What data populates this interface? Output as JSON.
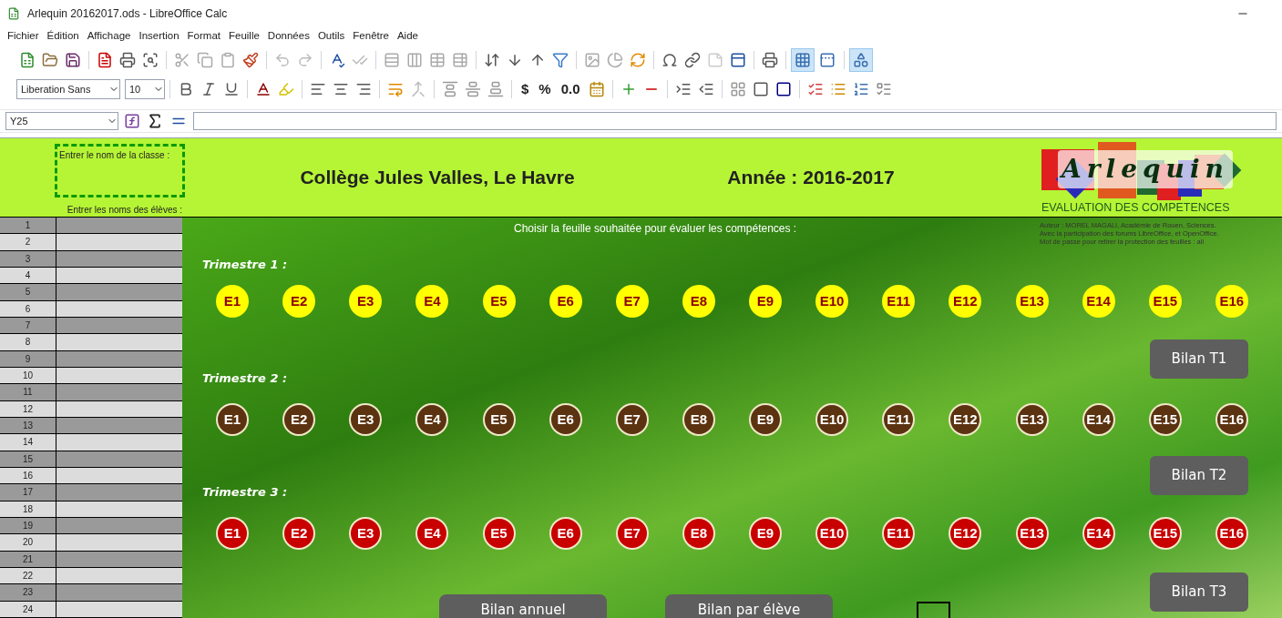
{
  "window": {
    "title": "Arlequin 20162017.ods - LibreOffice Calc"
  },
  "menu": [
    "Fichier",
    "Édition",
    "Affichage",
    "Insertion",
    "Format",
    "Feuille",
    "Données",
    "Outils",
    "Fenêtre",
    "Aide"
  ],
  "toolbar": {
    "view_toggles": [
      {
        "on": true
      },
      {
        "on": false
      },
      {
        "on": true
      }
    ],
    "font_name": "Liberation Sans",
    "font_size": "10",
    "format_buttons": [
      "$",
      "%",
      "0.0"
    ]
  },
  "formula_bar": {
    "name_box": "Y25"
  },
  "sheet": {
    "class_label": "Entrer le nom de la classe :",
    "students_label": "Entrer les noms des élèves :",
    "title": "Collège Jules Valles, Le Havre",
    "year": "Année : 2016-2017",
    "logo_text": "Arlequin",
    "logo_caption": "EVALUATION DES COMPETENCES",
    "author_lines": [
      "Auteur : MOREL MAGALI, Académie de Rouen, Sciences.",
      "Avec la participation des forums LibreOffice, et OpenOffice.",
      "Mot de passe pour retirer la protection des feuilles : ali"
    ],
    "instruction": "Choisir la feuille souhaitée pour évaluer les compétences :",
    "rows": [
      "1",
      "2",
      "3",
      "4",
      "5",
      "6",
      "7",
      "8",
      "9",
      "10",
      "11",
      "12",
      "13",
      "14",
      "15",
      "16",
      "17",
      "18",
      "19",
      "20",
      "21",
      "22",
      "23",
      "24"
    ],
    "trimestres": [
      {
        "label": "Trimestre 1 :",
        "kind": "light",
        "color": "#ffff00",
        "items": [
          "E1",
          "E2",
          "E3",
          "E4",
          "E5",
          "E6",
          "E7",
          "E8",
          "E9",
          "E10",
          "E11",
          "E12",
          "E13",
          "E14",
          "E15",
          "E16"
        ],
        "summary_button": "Bilan T1"
      },
      {
        "label": "Trimestre 2 :",
        "kind": "dark",
        "color": "#5c3311",
        "items": [
          "E1",
          "E2",
          "E3",
          "E4",
          "E5",
          "E6",
          "E7",
          "E8",
          "E9",
          "E10",
          "E11",
          "E12",
          "E13",
          "E14",
          "E15",
          "E16"
        ],
        "summary_button": "Bilan T2"
      },
      {
        "label": "Trimestre 3 :",
        "kind": "dark",
        "color": "#c80000",
        "items": [
          "E1",
          "E2",
          "E3",
          "E4",
          "E5",
          "E6",
          "E7",
          "E8",
          "E9",
          "E10",
          "E11",
          "E12",
          "E13",
          "E14",
          "E15",
          "E16"
        ],
        "summary_button": "Bilan T3"
      }
    ],
    "bottom_buttons": [
      "Bilan annuel",
      "Bilan par élève"
    ]
  }
}
